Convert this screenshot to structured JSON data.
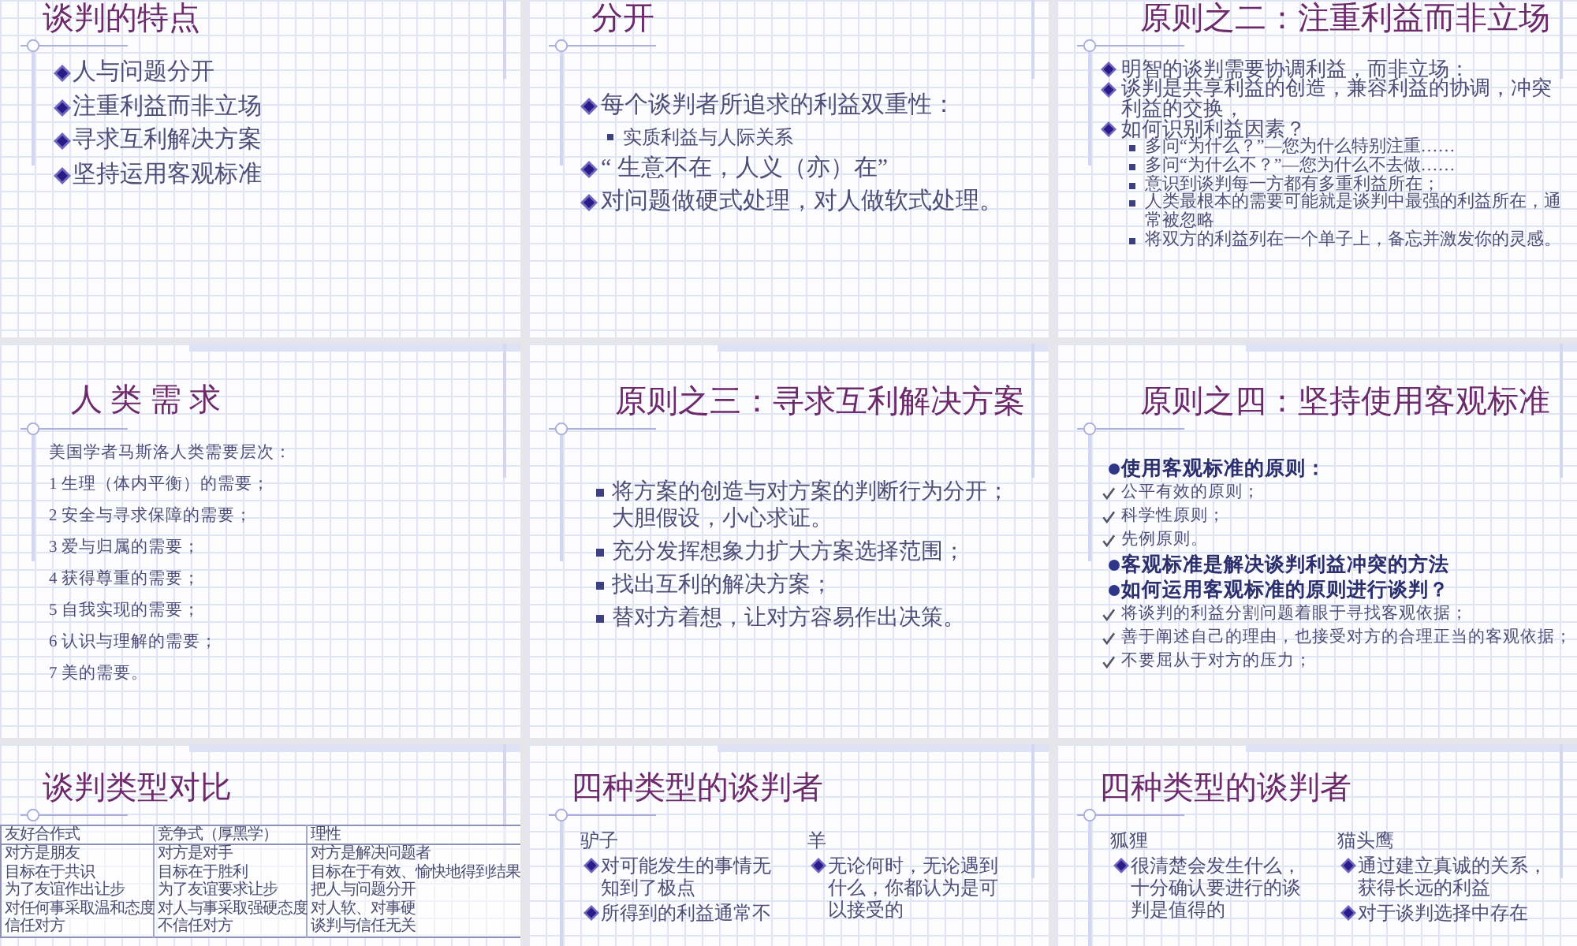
{
  "slides": [
    {
      "kind": "list",
      "title": "谈判的特点",
      "items": [
        {
          "kind": "diamond",
          "text": "人与问题分开"
        },
        {
          "kind": "diamond",
          "text": "注重利益而非立场"
        },
        {
          "kind": "diamond",
          "text": "寻求互利解决方案"
        },
        {
          "kind": "diamond",
          "text": "坚持运用客观标准"
        }
      ]
    },
    {
      "kind": "list",
      "title": "分开",
      "items": [
        {
          "kind": "diamond",
          "text": "每个谈判者所追求的利益双重性："
        },
        {
          "kind": "sub",
          "text": "实质利益与人际关系"
        },
        {
          "kind": "diamond",
          "text": "“ 生意不在，人义（亦）在”"
        },
        {
          "kind": "diamond",
          "text": "对问题做硬式处理，对人做软式处理。"
        }
      ]
    },
    {
      "kind": "list",
      "title": "原则之二：注重利益而非立场",
      "items": [
        {
          "kind": "diamond",
          "text": "明智的谈判需要协调利益，而非立场："
        },
        {
          "kind": "diamond",
          "text": "谈判是共享利益的创造，兼容利益的协调，冲突利益的交换，"
        },
        {
          "kind": "diamond",
          "text": "如何识别利益因素？"
        },
        {
          "kind": "sub",
          "text": "多问“为什么？”—您为什么特别注重……"
        },
        {
          "kind": "sub",
          "text": "多问“为什么不？”—您为什么不去做……"
        },
        {
          "kind": "sub",
          "text": "意识到谈判每一方都有多重利益所在；"
        },
        {
          "kind": "sub",
          "text": "人类最根本的需要可能就是谈判中最强的利益所在，通常被忽略"
        },
        {
          "kind": "sub",
          "text": "将双方的利益列在一个单子上，备忘并激发你的灵感。"
        }
      ]
    },
    {
      "kind": "list",
      "title": "人 类 需 求",
      "items": [
        {
          "kind": "plain",
          "text": "美国学者马斯洛人类需要层次："
        },
        {
          "kind": "plain",
          "text": "1 生理（体内平衡）的需要；"
        },
        {
          "kind": "plain",
          "text": "2 安全与寻求保障的需要；"
        },
        {
          "kind": "plain",
          "text": "3 爱与归属的需要；"
        },
        {
          "kind": "plain",
          "text": "4 获得尊重的需要；"
        },
        {
          "kind": "plain",
          "text": "5 自我实现的需要；"
        },
        {
          "kind": "plain",
          "text": "6 认识与理解的需要；"
        },
        {
          "kind": "plain",
          "text": "7 美的需要。"
        }
      ]
    },
    {
      "kind": "list",
      "title": "原则之三：寻求互利解决方案",
      "items": [
        {
          "kind": "square",
          "text": "将方案的创造与对方案的判断行为分开；大胆假设，小心求证。"
        },
        {
          "kind": "square",
          "text": "充分发挥想象力扩大方案选择范围；"
        },
        {
          "kind": "square",
          "text": "找出互利的解决方案；"
        },
        {
          "kind": "square",
          "text": "替对方着想，让对方容易作出决策。"
        }
      ]
    },
    {
      "kind": "list",
      "title": "原则之四：坚持使用客观标准",
      "items": [
        {
          "kind": "dot",
          "text": "使用客观标准的原则："
        },
        {
          "kind": "check",
          "text": "公平有效的原则；"
        },
        {
          "kind": "check",
          "text": "科学性原则；"
        },
        {
          "kind": "check",
          "text": "先例原则。"
        },
        {
          "kind": "dot",
          "text": "客观标准是解决谈判利益冲突的方法"
        },
        {
          "kind": "dot",
          "text": "如何运用客观标准的原则进行谈判？"
        },
        {
          "kind": "check",
          "text": "将谈判的利益分割问题着眼于寻找客观依据；"
        },
        {
          "kind": "check",
          "text": "善于阐述自己的理由，也接受对方的合理正当的客观依据；"
        },
        {
          "kind": "check",
          "text": "不要屈从于对方的压力；"
        }
      ]
    },
    {
      "kind": "table",
      "title": "谈判类型对比",
      "columns": [
        "友好合作式",
        "竞争式（厚黑学）",
        "理性"
      ],
      "rows": [
        [
          "对方是朋友",
          "对方是对手",
          "对方是解决问题者"
        ],
        [
          "目标在于共识",
          "目标在于胜利",
          "目标在于有效、愉快地得到结果"
        ],
        [
          "为了友谊作出让步",
          "为了友谊要求让步",
          "把人与问题分开"
        ],
        [
          "对任何事采取温和态度",
          "对人与事采取强硬态度",
          "对人软、对事硬"
        ],
        [
          "信任对方",
          "不信任对方",
          "谈判与信任无关"
        ]
      ]
    },
    {
      "kind": "columns",
      "title": "四种类型的谈判者",
      "columns": [
        {
          "label": "驴子",
          "items": [
            "对可能发生的事情无知到了极点",
            "所得到的利益通常不"
          ]
        },
        {
          "label": "羊",
          "items": [
            "无论何时，无论遇到什么，你都认为是可以接受的"
          ]
        }
      ]
    },
    {
      "kind": "columns",
      "title": "四种类型的谈判者",
      "columns": [
        {
          "label": "狐狸",
          "items": [
            "很清楚会发生什么，十分确认要进行的谈判是值得的"
          ]
        },
        {
          "label": "猫头鹰",
          "items": [
            "通过建立真诚的关系，获得长远的利益",
            "对于谈判选择中存在"
          ]
        }
      ]
    }
  ]
}
